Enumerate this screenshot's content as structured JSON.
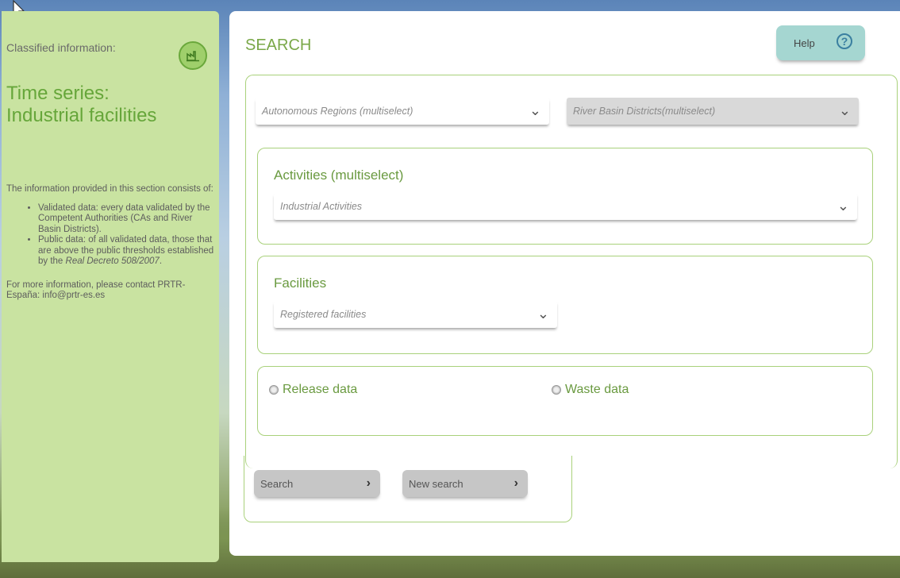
{
  "sidebar": {
    "label": "Classified information:",
    "icon": "factory-icon",
    "title_line1": "Time series:",
    "title_line2": "Industrial facilities",
    "intro": "The information provided in this section consists of:",
    "bullet1": "Validated data: every data validated by the Competent Authorities (CAs and River Basin Districts).",
    "bullet2_a": "Public data: of all validated data, those that are above the public thresholds established by the ",
    "bullet2_b": "Real Decreto 508/2007",
    "bullet2_c": ".",
    "contact": "For more information, please contact PRTR-España: info@prtr-es.es"
  },
  "main": {
    "title": "SEARCH",
    "help_label": "Help",
    "help_icon": "?",
    "regions_placeholder": "Autonomous Regions (multiselect)",
    "basins_placeholder": "River Basin Districts(multiselect)",
    "activities_title": "Activities (multiselect)",
    "activities_placeholder": "Industrial Activities",
    "facilities_title": "Facilities",
    "facilities_placeholder": "Registered facilities",
    "release_label": "Release data",
    "waste_label": "Waste data",
    "search_button": "Search",
    "new_search_button": "New search",
    "chevron": "⌄",
    "arrow": "›"
  },
  "colors": {
    "sidebar_bg": "#c9e3a1",
    "accent_green": "#7aa848",
    "border_green": "#a9d17b",
    "help_bg": "#a5d6d1"
  }
}
